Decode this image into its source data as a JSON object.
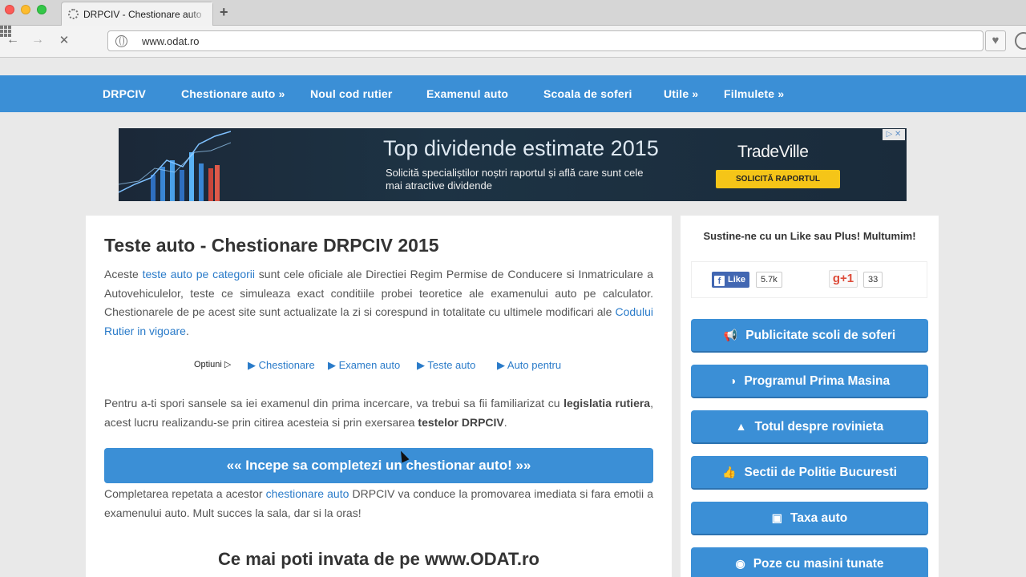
{
  "browser": {
    "tab_title": "DRPCIV - Chestionare auto online",
    "url": "www.odat.ro"
  },
  "nav": {
    "items": [
      "DRPCIV",
      "Chestionare auto »",
      "Noul cod rutier",
      "Examenul auto",
      "Scoala de soferi",
      "Utile »",
      "Filmulete »"
    ]
  },
  "banner": {
    "title": "Top dividende estimate 2015",
    "subtitle": "Solicită specialiștilor noștri raportul și află care sunt cele mai atractive dividende",
    "brand": "TradeVille",
    "cta": "SOLICITĂ RAPORTUL"
  },
  "main": {
    "title": "Teste auto - Chestionare DRPCIV 2015",
    "p1": {
      "t1": "Aceste ",
      "link1": "teste auto pe categorii",
      "t2": " sunt cele oficiale ale Directiei Regim Permise de Conducere si Inmatriculare a Autovehiculelor, teste ce simuleaza exact conditiile probei teoretice ale examenului auto pe calculator. Chestionarele de pe acest site sunt actualizate la zi si corespund in totalitate cu ultimele modificari ale ",
      "link2": "Codului Rutier in vigoare",
      "t3": "."
    },
    "options": {
      "label": "Optiuni ▷",
      "links": [
        "▶ Chestionare",
        "▶ Examen auto",
        "▶ Teste auto",
        "▶ Auto pentru"
      ]
    },
    "p2": {
      "t1": "Pentru a-ti spori sansele sa iei examenul din prima incercare, va trebui sa fii familiarizat cu ",
      "b1": "legislatia rutiera",
      "t2": ", acest lucru realizandu-se prin citirea acesteia si prin exersarea ",
      "b2": "testelor DRPCIV",
      "t3": "."
    },
    "cta": "«« Incepe sa completezi un chestionar auto! »»",
    "p3": {
      "t1": "Completarea repetata a acestor ",
      "link": "chestionare auto",
      "t2": " DRPCIV va conduce la promovarea imediata si fara emotii a examenului auto. Mult succes la sala, dar si la oras!"
    },
    "subtitle": "Ce mai poti invata de pe www.ODAT.ro"
  },
  "sidebar": {
    "heading": "Sustine-ne cu un Like sau Plus! Multumim!",
    "like_label": "Like",
    "like_count": "5.7k",
    "gplus_label": "g+1",
    "gplus_count": "33",
    "buttons": [
      {
        "label": "Publicitate scoli de soferi",
        "icon": "megaphone-icon"
      },
      {
        "label": "Programul Prima Masina",
        "icon": "speedometer-icon"
      },
      {
        "label": "Totul despre rovinieta",
        "icon": "road-icon"
      },
      {
        "label": "Sectii de Politie Bucuresti",
        "icon": "thumbs-up-icon"
      },
      {
        "label": "Taxa auto",
        "icon": "money-icon"
      },
      {
        "label": "Poze cu masini tunate",
        "icon": "camera-icon"
      }
    ]
  },
  "colors": {
    "primary": "#3b8fd6",
    "link": "#2a7bc9",
    "banner_cta": "#f5c518"
  }
}
